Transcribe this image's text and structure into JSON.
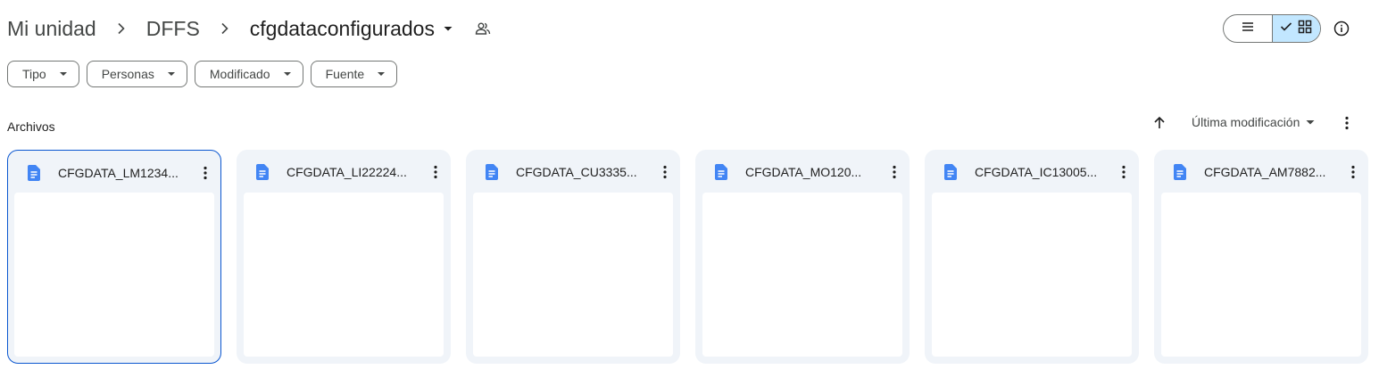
{
  "breadcrumb": {
    "items": [
      "Mi unidad",
      "DFFS"
    ],
    "current": "cfgdataconfigurados"
  },
  "view_toggle": {
    "list_icon": "list-view-icon",
    "grid_icon": "grid-view-icon",
    "active": "grid"
  },
  "filters": {
    "chips": [
      "Tipo",
      "Personas",
      "Modificado",
      "Fuente"
    ]
  },
  "section": {
    "title": "Archivos",
    "sort_label": "Última modificación"
  },
  "files": [
    {
      "name": "CFGDATA_LM1234...",
      "icon": "google-docs-icon",
      "selected": true
    },
    {
      "name": "CFGDATA_LI22224...",
      "icon": "google-docs-icon",
      "selected": false
    },
    {
      "name": "CFGDATA_CU3335...",
      "icon": "google-docs-icon",
      "selected": false
    },
    {
      "name": "CFGDATA_MO120...",
      "icon": "google-docs-icon",
      "selected": false
    },
    {
      "name": "CFGDATA_IC13005...",
      "icon": "google-docs-icon",
      "selected": false
    },
    {
      "name": "CFGDATA_AM7882...",
      "icon": "google-docs-icon",
      "selected": false
    }
  ],
  "colors": {
    "accent": "#0b57d0",
    "doc_blue": "#4285f4",
    "toggle_active": "#c2e7ff",
    "card_bg": "#f0f4f9"
  }
}
